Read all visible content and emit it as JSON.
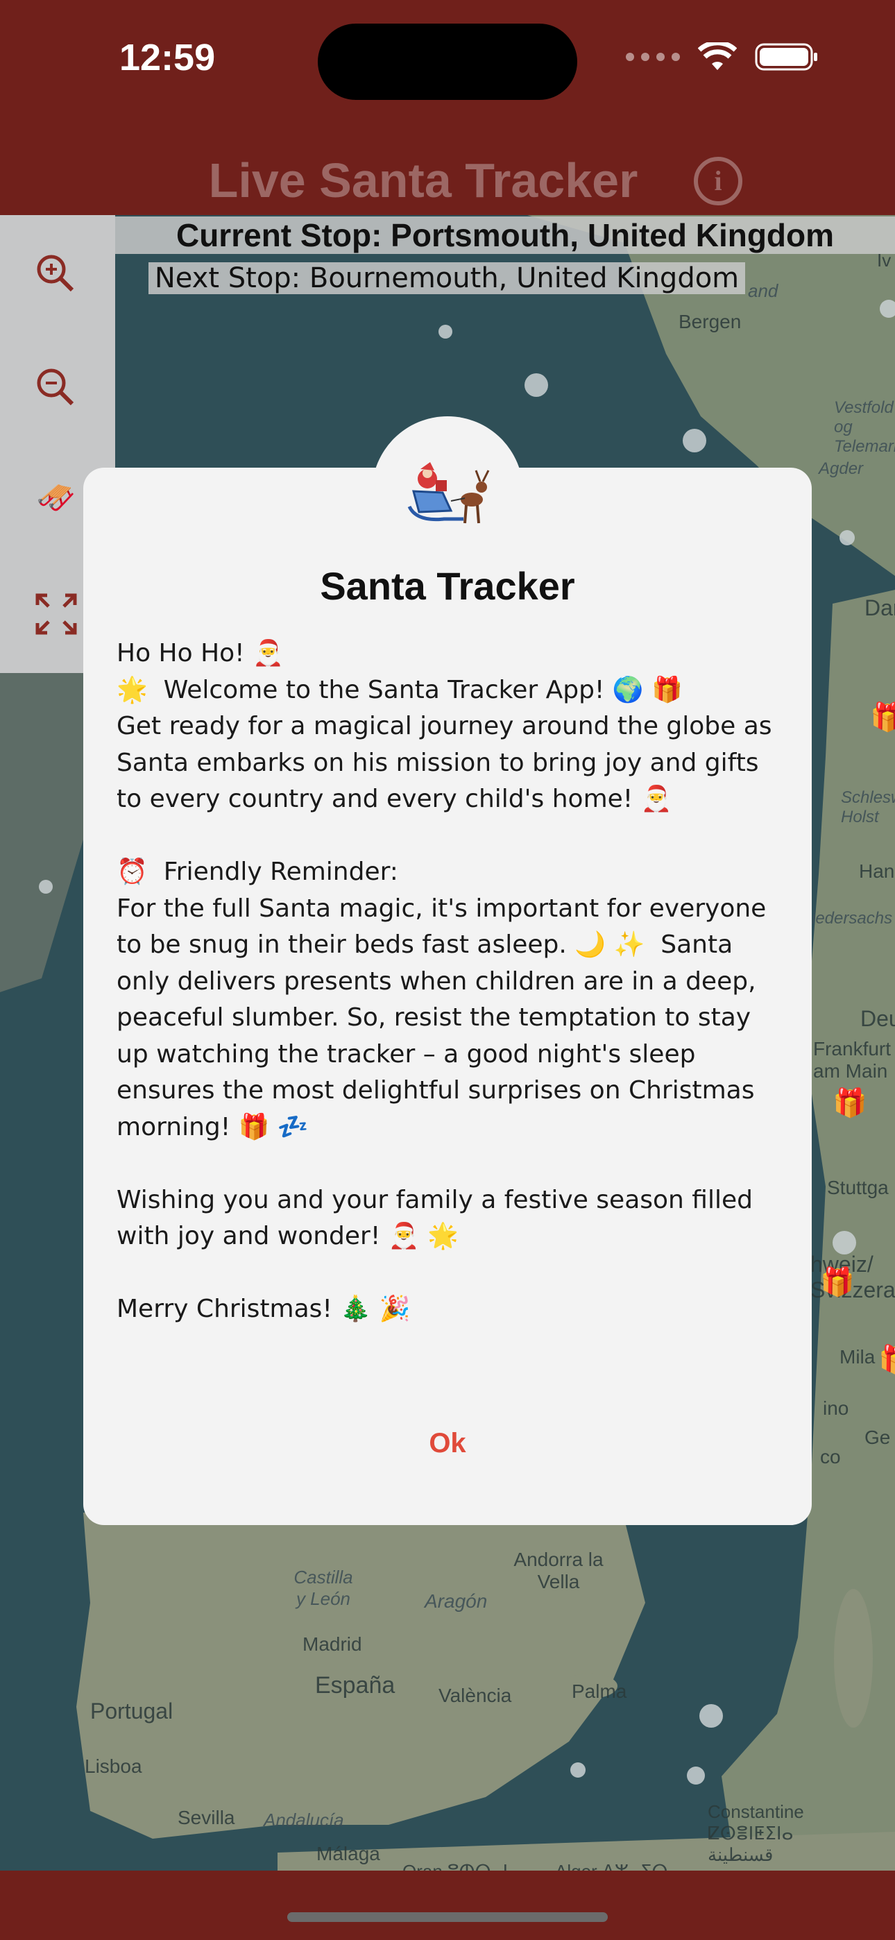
{
  "status_bar": {
    "time": "12:59"
  },
  "header": {
    "title": "Live Santa Tracker",
    "info_icon": "info-icon"
  },
  "stops": {
    "current": "Current Stop: Portsmouth, United Kingdom",
    "next": "Next Stop: Bournemouth, United Kingdom"
  },
  "controls": [
    {
      "name": "zoom-in-icon",
      "glyph": "⊕"
    },
    {
      "name": "zoom-out-icon",
      "glyph": "⊖"
    },
    {
      "name": "santa-sleigh-icon",
      "glyph": "🛷"
    },
    {
      "name": "fullscreen-icon",
      "glyph": "⛶"
    }
  ],
  "map_labels": {
    "bergen": "Bergen",
    "vestfold": "Vestfold og Telemark",
    "agder": "Agder",
    "danmark": "Danm",
    "schleswig": "Schlesw Holst",
    "han": "Han",
    "niedersachs": "iedersachs",
    "deu": "Deu",
    "frankfurt": "Frankfurt am Main",
    "stuttga": "Stuttga",
    "schweiz": "hweiz/ Svizzera",
    "mila": "Mila",
    "ino": "ino",
    "co": "co",
    "ge": "Ge",
    "andorra": "Andorra la Vella",
    "aragon": "Aragón",
    "castilla": "Castilla y León",
    "madrid": "Madrid",
    "espana": "España",
    "valencia": "València",
    "palma": "Palma",
    "portugal": "Portugal",
    "lisboa": "Lisboa",
    "sevilla": "Sevilla",
    "andalucia": "Andalucía",
    "malaga": "Málaga",
    "oran": "Oran ⵓⵀⵔⴰⵏ",
    "alger": "Alger ⴷⵣⴰⵢⵔ",
    "constantine": "Constantine ⵇⵙⴻⵏⵟⵉⵏⴰ قسنطينة",
    "and_top": "and",
    "iv": "Iv"
  },
  "dialog": {
    "title": "Santa Tracker",
    "body": "Ho Ho Ho! 🎅\n🌟  Welcome to the Santa Tracker App! 🌍 🎁\nGet ready for a magical journey around the globe as Santa embarks on his mission to bring joy and gifts to every country and every child's home! 🎅\n\n⏰  Friendly Reminder:\nFor the full Santa magic, it's important for everyone to be snug in their beds fast asleep. 🌙 ✨  Santa only delivers presents when children are in a deep, peaceful slumber. So, resist the temptation to stay up watching the tracker – a good night's sleep ensures the most delightful surprises on Christmas morning! 🎁 💤\n\nWishing you and your family a festive season filled with joy and wonder! 🎅 🌟\n\nMerry Christmas! 🎄 🎉",
    "ok_label": "Ok"
  }
}
